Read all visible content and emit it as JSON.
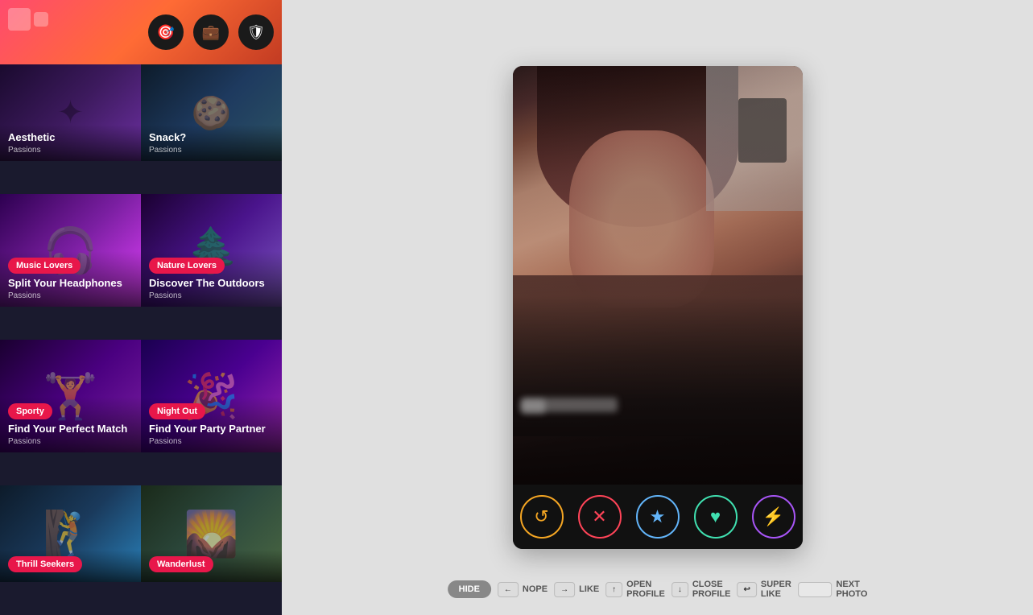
{
  "header": {
    "icon1": "🎯",
    "icon2": "💼",
    "icon3": "🛡"
  },
  "cards": [
    {
      "id": "aesthetic",
      "title": "Aesthetic",
      "subtitle": "Passions",
      "badge": null,
      "bg": "card-aesthetic",
      "deco": "✦"
    },
    {
      "id": "snack",
      "title": "Snack?",
      "subtitle": "Passions",
      "badge": null,
      "bg": "card-snack",
      "deco": "🍪"
    },
    {
      "id": "music",
      "title": "Split Your Headphones",
      "subtitle": "Passions",
      "badge": "Music Lovers",
      "bg": "card-music",
      "deco": "🎧"
    },
    {
      "id": "nature",
      "title": "Discover The Outdoors",
      "subtitle": "Passions",
      "badge": "Nature Lovers",
      "bg": "card-nature",
      "deco": "🌲"
    },
    {
      "id": "sporty",
      "title": "Find Your Perfect Match",
      "subtitle": "Passions",
      "badge": "Sporty",
      "bg": "card-sporty",
      "deco": "🏋"
    },
    {
      "id": "nightout",
      "title": "Find Your Party Partner",
      "subtitle": "Passions",
      "badge": "Night Out",
      "bg": "card-nightout",
      "deco": "🎉"
    },
    {
      "id": "thrill",
      "title": "Thrill Seekers",
      "subtitle": "",
      "badge": "Thrill Seekers",
      "bg": "card-thrill",
      "deco": "🧗"
    },
    {
      "id": "wanderlust",
      "title": "Wanderlust",
      "subtitle": "",
      "badge": "Wanderlust",
      "bg": "card-wanderlust",
      "deco": "🌄"
    }
  ],
  "actions": [
    {
      "id": "rewind",
      "icon": "↺",
      "class": "btn-rewind"
    },
    {
      "id": "nope",
      "icon": "✕",
      "class": "btn-nope"
    },
    {
      "id": "star",
      "icon": "★",
      "class": "btn-star"
    },
    {
      "id": "like",
      "icon": "♥",
      "class": "btn-like"
    },
    {
      "id": "boost",
      "icon": "⚡",
      "class": "btn-boost"
    }
  ],
  "keyboard_bar": {
    "hide_label": "HIDE",
    "items": [
      {
        "id": "nope",
        "key_icon": "←",
        "label": "NOPE"
      },
      {
        "id": "like",
        "key_icon": "→",
        "label": "LIKE"
      },
      {
        "id": "open_profile",
        "key_icon": "↑",
        "label": "OPEN PROFILE"
      },
      {
        "id": "close_profile",
        "key_icon": "↓",
        "label": "CLOSE PROFILE"
      },
      {
        "id": "super_like",
        "key_icon": "↩",
        "label": "SUPER LIKE"
      },
      {
        "id": "next_photo",
        "label": "NEXT PHOTO"
      }
    ]
  }
}
